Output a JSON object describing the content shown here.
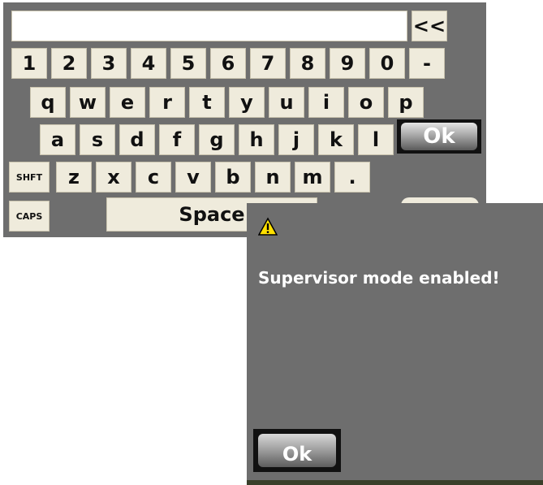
{
  "input": {
    "value": ""
  },
  "keyboard": {
    "backspace": "<<",
    "row_numbers": [
      "1",
      "2",
      "3",
      "4",
      "5",
      "6",
      "7",
      "8",
      "9",
      "0",
      "-"
    ],
    "row_q": [
      "q",
      "w",
      "e",
      "r",
      "t",
      "y",
      "u",
      "i",
      "o",
      "p"
    ],
    "row_a": [
      "a",
      "s",
      "d",
      "f",
      "g",
      "h",
      "j",
      "k",
      "l"
    ],
    "row_z": [
      "z",
      "x",
      "c",
      "v",
      "b",
      "n",
      "m",
      "."
    ],
    "shift": "SHFT",
    "caps": "CAPS",
    "space": "Space",
    "ok": "Ok"
  },
  "dialog": {
    "icon": "warning-icon",
    "message": "Supervisor mode enabled!",
    "ok": "Ok"
  },
  "colors": {
    "panel": "#6e6e6e",
    "key": "#efebdc",
    "warning": "#ffe000"
  }
}
